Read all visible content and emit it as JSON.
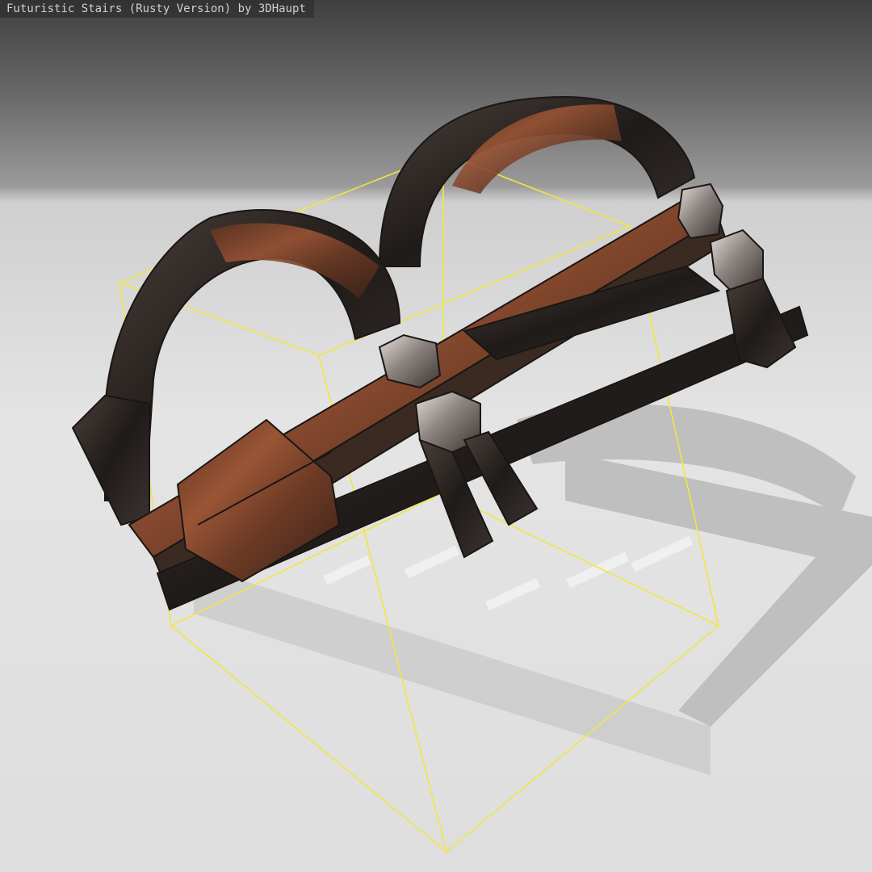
{
  "viewer": {
    "title": "Futuristic Stairs (Rusty Version) by 3DHaupt"
  },
  "colors": {
    "bounding_box": "#f2e640",
    "rust": "#8a4a2c",
    "dark_metal": "#2a2624",
    "chrome": "#b8b0aa",
    "floor": "#e2e2e2",
    "shadow": "#b9b9b9"
  },
  "scene": {
    "object": "futuristic-stairs-model",
    "bounding_box_visible": true,
    "material": "rusty-metal"
  }
}
